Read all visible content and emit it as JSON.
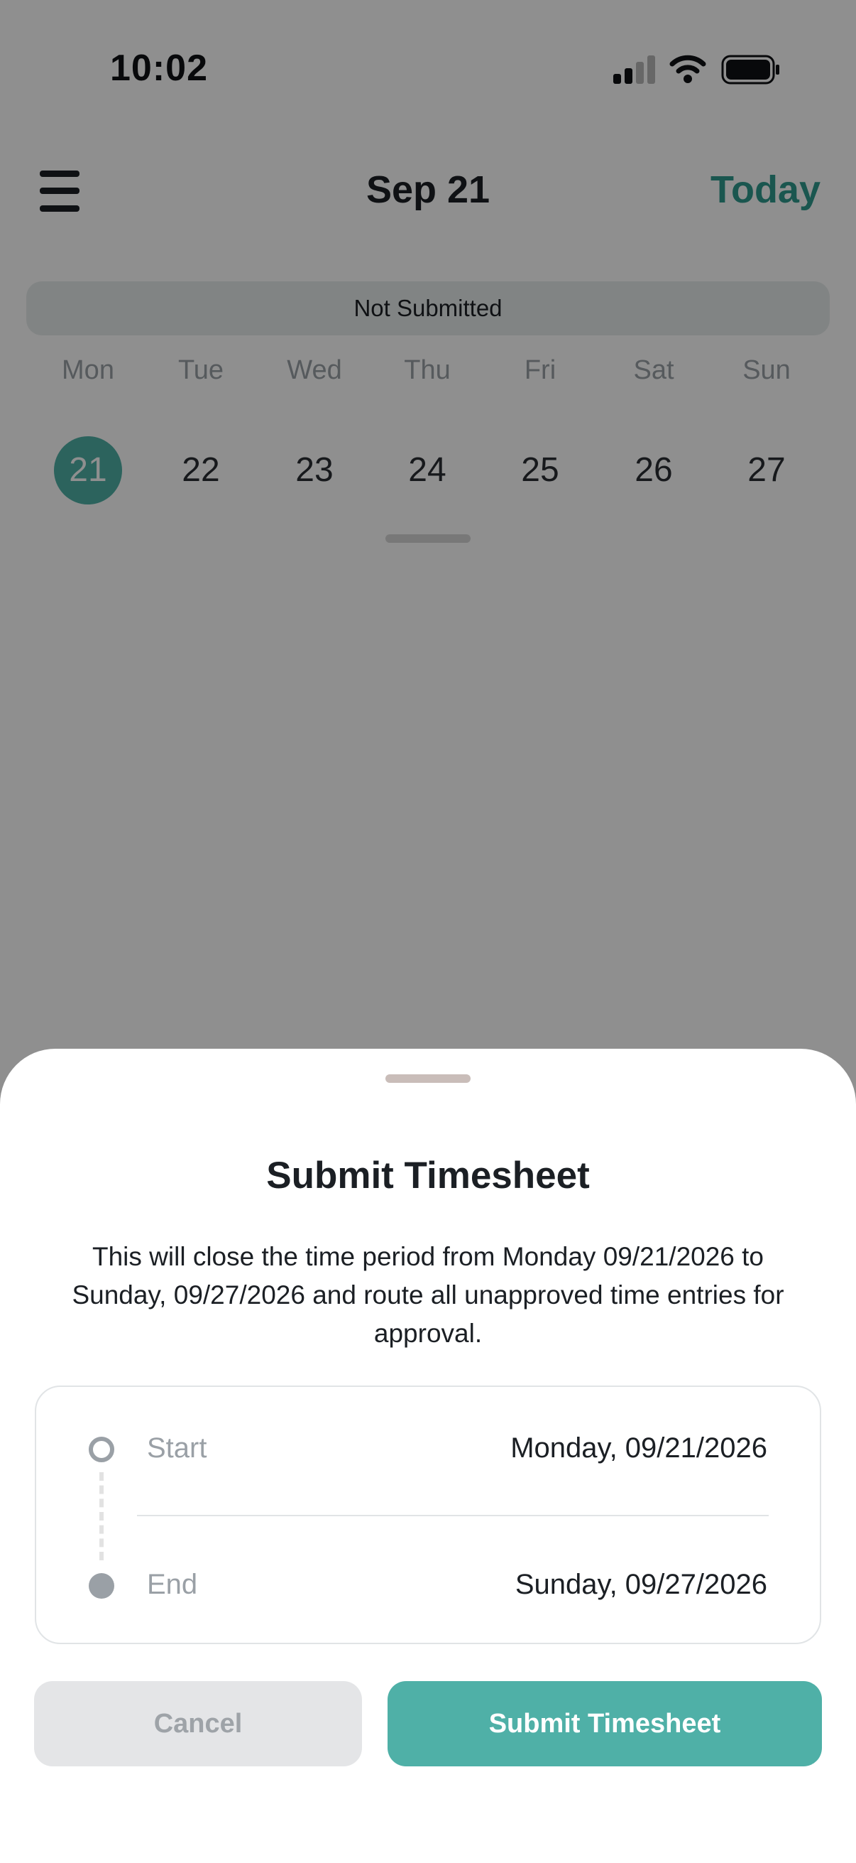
{
  "status_bar": {
    "time": "10:02",
    "icons": [
      "signal-icon",
      "wifi-icon",
      "battery-icon"
    ]
  },
  "header": {
    "menu_icon": "menu-icon",
    "title": "Sep 21",
    "today_label": "Today"
  },
  "timesheet_status": "Not Submitted",
  "week": {
    "days": [
      {
        "label": "Mon",
        "date": "21",
        "selected": true
      },
      {
        "label": "Tue",
        "date": "22",
        "selected": false
      },
      {
        "label": "Wed",
        "date": "23",
        "selected": false
      },
      {
        "label": "Thu",
        "date": "24",
        "selected": false
      },
      {
        "label": "Fri",
        "date": "25",
        "selected": false
      },
      {
        "label": "Sat",
        "date": "26",
        "selected": false
      },
      {
        "label": "Sun",
        "date": "27",
        "selected": false
      }
    ]
  },
  "sheet": {
    "title": "Submit Timesheet",
    "description": "This will close the time period from Monday 09/21/2026 to Sunday, 09/27/2026 and route all unapproved time entries for approval.",
    "range": {
      "start_label": "Start",
      "start_value": "Monday, 09/21/2026",
      "end_label": "End",
      "end_value": "Sunday, 09/27/2026"
    },
    "cancel_label": "Cancel",
    "submit_label": "Submit Timesheet"
  },
  "colors": {
    "accent": "#4fb0a7",
    "accent_text": "#2f9a8d",
    "muted": "#9aa0a6",
    "scrim": "rgba(0,0,0,0.44)"
  }
}
